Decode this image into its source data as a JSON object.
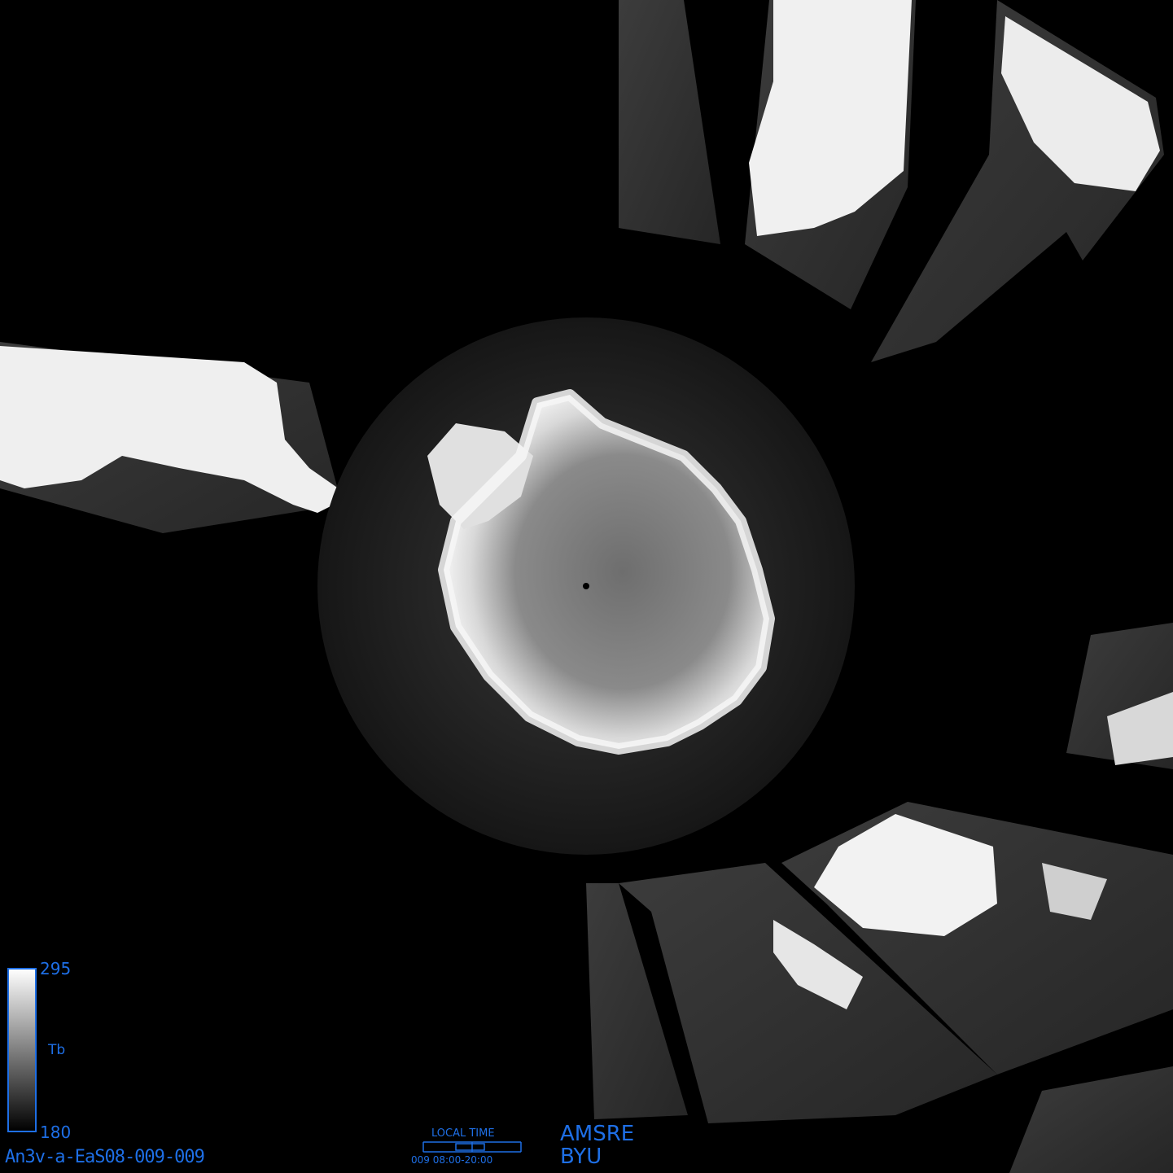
{
  "colorbar": {
    "max_label": "295",
    "min_label": "180",
    "unit_label": "Tb",
    "gradient_top_color": "#ffffff",
    "gradient_bottom_color": "#000000",
    "frame_color": "#1e6fe6"
  },
  "image_id": "An3v-a-EaS08-009-009",
  "local_time": {
    "title": "LOCAL TIME",
    "range_text": "009  08:00-20:00"
  },
  "source": {
    "line1": "AMSRE",
    "line2": "BYU"
  },
  "colors": {
    "annotation": "#1e6fe6",
    "background": "#000000",
    "ice_sheet": "#e8e8e8",
    "ocean": "#2a2a2a",
    "land": "#f2f2f2"
  }
}
